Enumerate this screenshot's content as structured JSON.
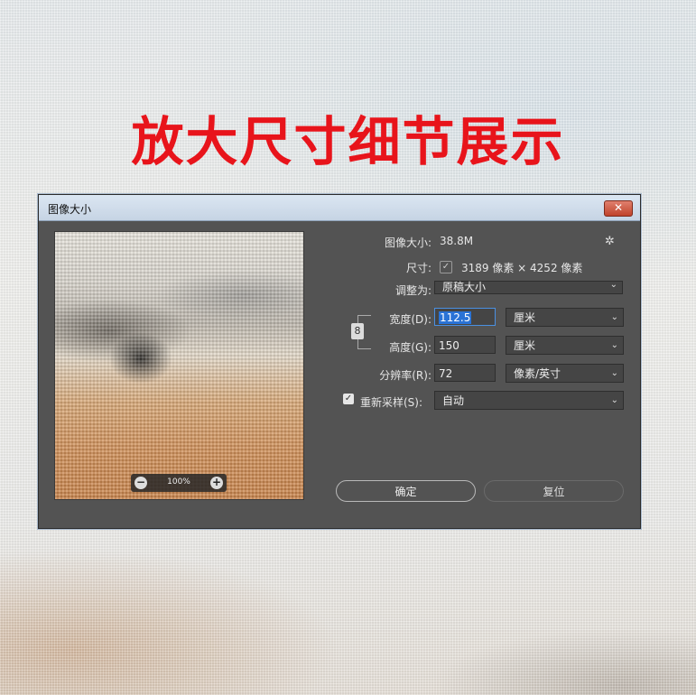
{
  "headline": "放大尺寸细节展示",
  "dialog": {
    "title": "图像大小",
    "close_label": "✕",
    "zoom": {
      "value": "100%",
      "minus": "−",
      "plus": "+"
    },
    "image_size": {
      "label": "图像大小:",
      "value": "38.8M"
    },
    "dimensions": {
      "label": "尺寸:",
      "value": "3189 像素 × 4252 像素",
      "check": "✓"
    },
    "fit_to": {
      "label": "调整为:",
      "value": "原稿大小"
    },
    "width": {
      "label": "宽度(D):",
      "value": "112.5",
      "unit": "厘米"
    },
    "height": {
      "label": "高度(G):",
      "value": "150",
      "unit": "厘米"
    },
    "resolution": {
      "label": "分辨率(R):",
      "value": "72",
      "unit": "像素/英寸"
    },
    "resample": {
      "label": "重新采样(S):",
      "value": "自动",
      "checked": true,
      "check": "✓"
    },
    "link_icon": "8",
    "gear_icon": "✲",
    "chevron": "⌄",
    "ok_label": "确定",
    "reset_label": "复位"
  },
  "icons": {
    "close": "close-icon",
    "gear": "gear-icon",
    "link": "link-icon",
    "chevron": "chevron-down-icon",
    "zoom_in": "zoom-in-icon",
    "zoom_out": "zoom-out-icon"
  },
  "colors": {
    "headline": "#e8141b",
    "dialog_bg": "#535353",
    "selection": "#2a73d6",
    "focus": "#4a90e2"
  }
}
